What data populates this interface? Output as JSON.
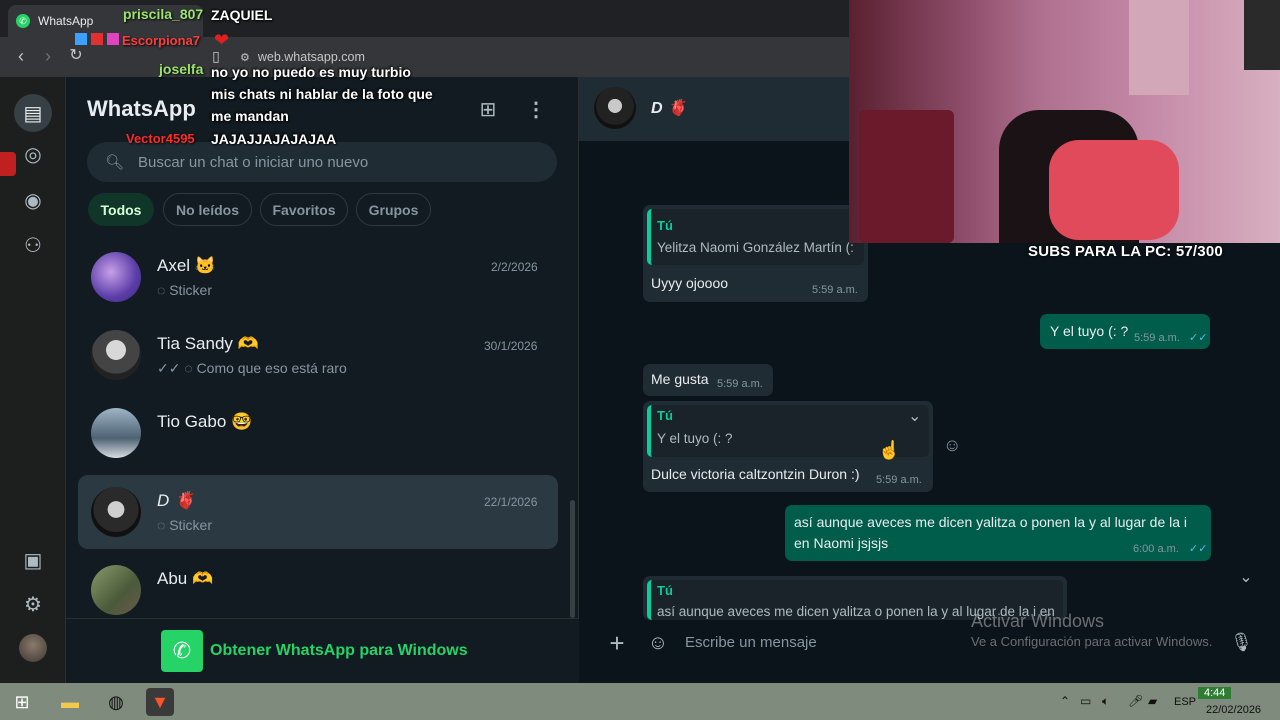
{
  "browser": {
    "tab_title": "WhatsApp",
    "url": "web.whatsapp.com"
  },
  "app": {
    "title": "WhatsApp",
    "search_placeholder": "Buscar un chat o iniciar uno nuevo",
    "filters": [
      "Todos",
      "No leídos",
      "Favoritos",
      "Grupos"
    ],
    "get_windows": "Obtener WhatsApp para Windows"
  },
  "chats": [
    {
      "name": "Axel 🐱",
      "date": "2/2/2026",
      "preview": "Sticker"
    },
    {
      "name": "Tia Sandy 🫶",
      "date": "30/1/2026",
      "preview": "Como que eso está raro"
    },
    {
      "name": "Tio Gabo 🤓",
      "date": "",
      "preview": ""
    },
    {
      "name": "D 🫀",
      "date": "22/1/2026",
      "preview": "Sticker"
    },
    {
      "name": "Abu 🫶",
      "date": "",
      "preview": ""
    }
  ],
  "conversation": {
    "contact": "D 🫀",
    "messages": [
      {
        "quote_name": "Tú",
        "quote_text": "Yelitza Naomi González Martín (:",
        "text": "Uyyy ojoooo",
        "time": "5:59 a.m."
      },
      {
        "text": "Y el tuyo (: ?",
        "time": "5:59 a.m."
      },
      {
        "text": "Me gusta",
        "time": "5:59 a.m."
      },
      {
        "quote_name": "Tú",
        "quote_text": "Y el tuyo (: ?",
        "text": "Dulce victoria caltzontzin Duron :)",
        "time": "5:59 a.m."
      },
      {
        "text": "así aunque aveces me dicen yalitza o ponen la y al lugar de la i en Naomi jsjsjs",
        "time": "6:00 a.m."
      },
      {
        "quote_name": "Tú",
        "quote_text": "así aunque aveces me dicen yalitza o ponen la y al lugar de la i en"
      }
    ],
    "composer_placeholder": "Escribe un mensaje"
  },
  "overlay": {
    "chat": [
      {
        "user": "priscila_807",
        "text": "ZAQUIEL",
        "color": "#9be36b"
      },
      {
        "user": "Escorpiona7",
        "text": "",
        "color": "#ff3b3b"
      },
      {
        "user": "joselfa",
        "text": "no yo no puedo es muy turbio mis chats ni hablar de la foto que me mandan",
        "color": "#9be36b"
      },
      {
        "user": "Vector4595",
        "text": "JAJAJJAJAJAJAA",
        "color": "#ff2a2a"
      }
    ],
    "subs": "SUBS PARA LA PC: 57/300"
  },
  "windows": {
    "activate_title": "Activar Windows",
    "activate_sub": "Ve a Configuración para activar Windows.",
    "time": "4:44",
    "date": "22/02/2026",
    "lang": "ESP"
  }
}
